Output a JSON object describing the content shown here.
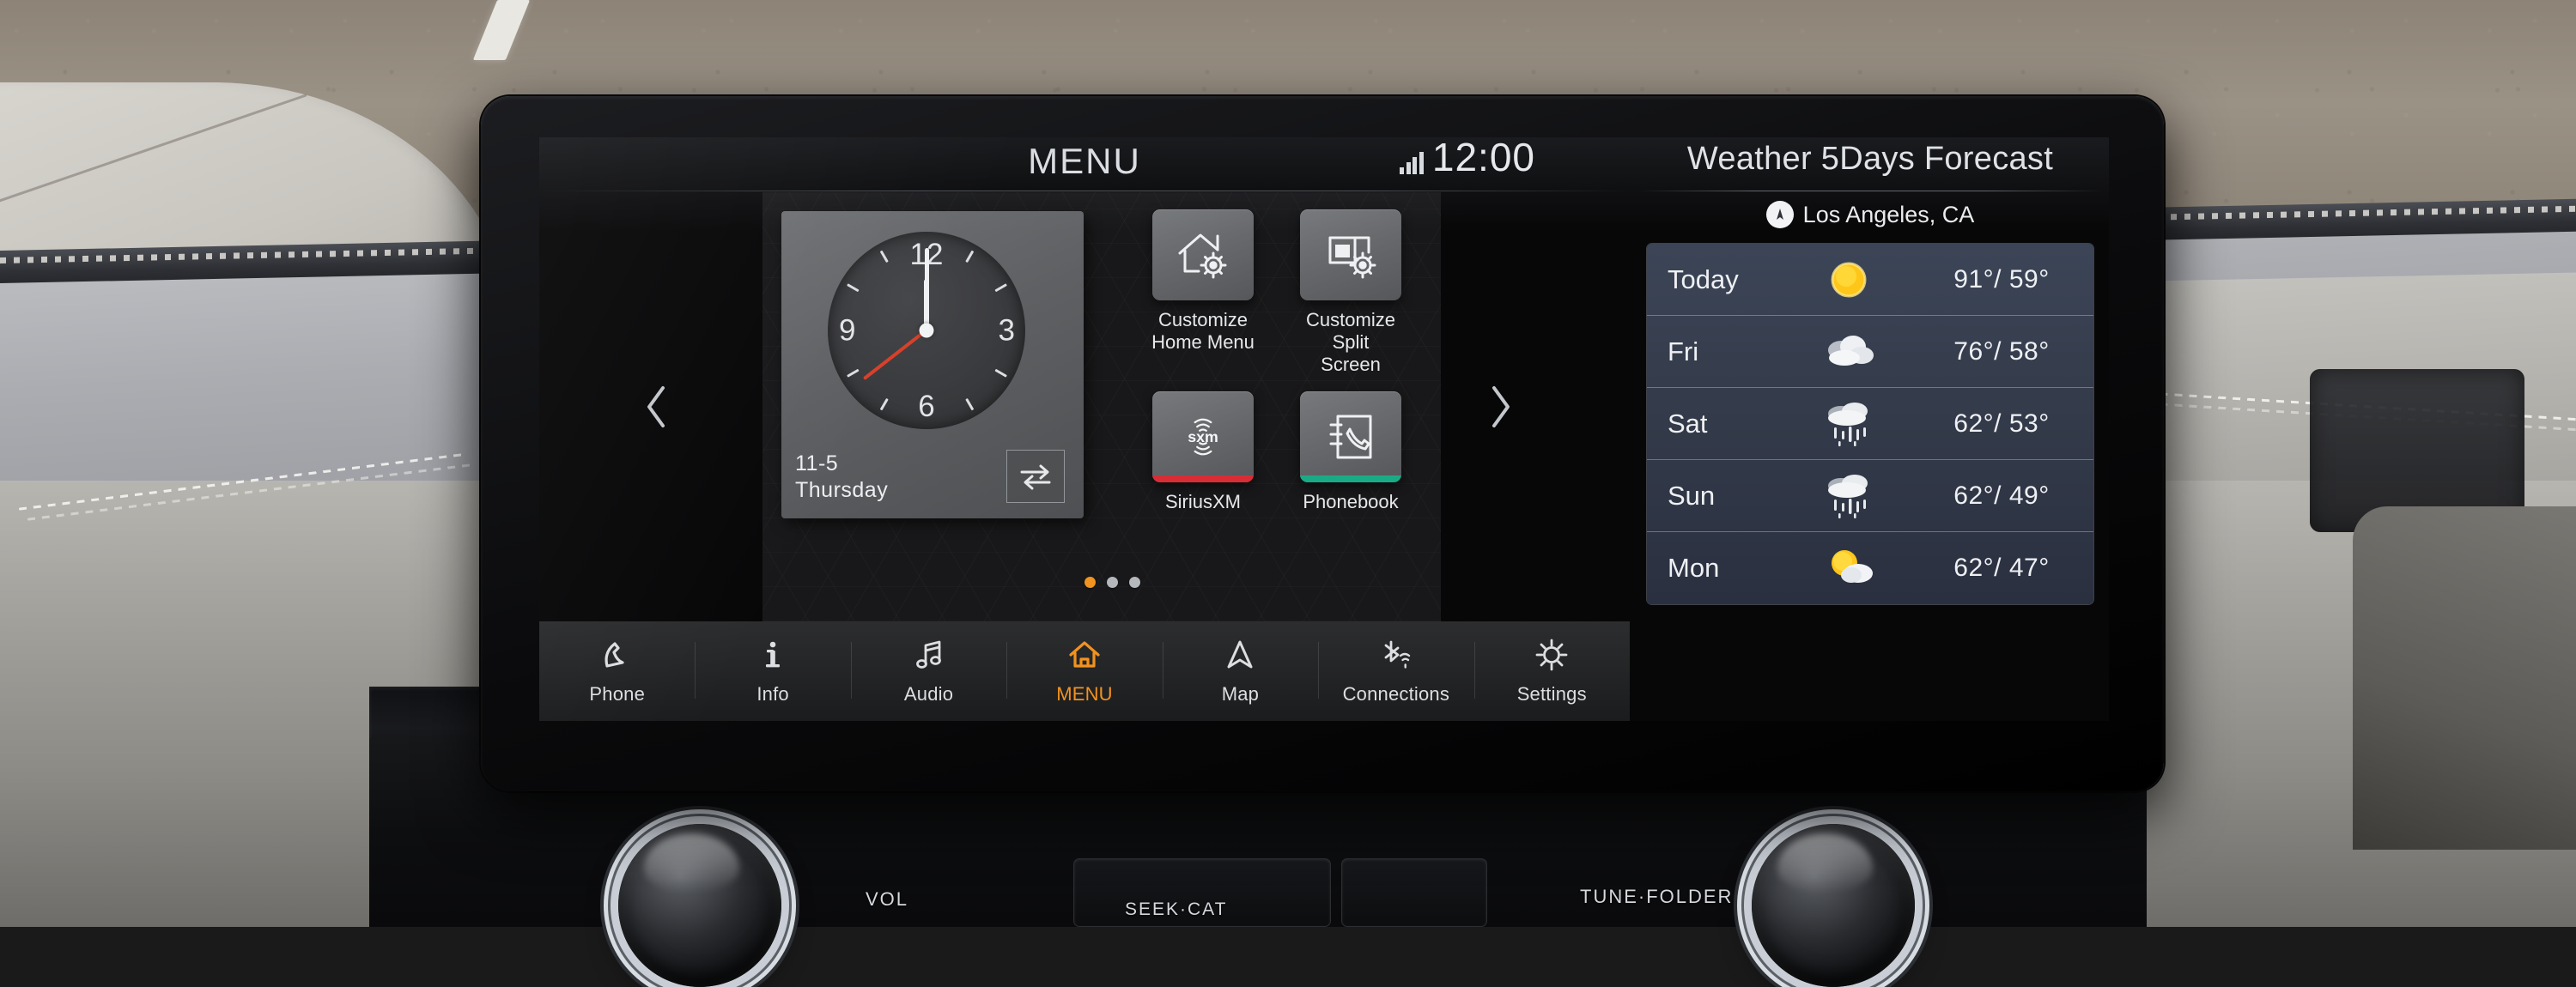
{
  "statusbar": {
    "title": "MENU",
    "time": "12:00",
    "signal_icon": "antenna-signal-bars-icon"
  },
  "home": {
    "prev_icon": "chevron-left-icon",
    "next_icon": "chevron-right-icon",
    "clock_widget": {
      "numerals": [
        "12",
        "3",
        "6",
        "9"
      ],
      "hour_angle": 0,
      "minute_angle": 0,
      "second_angle": -128,
      "date": "11-5",
      "weekday": "Thursday",
      "swap_icon": "swap-arrows-icon"
    },
    "tiles": [
      {
        "label": "Customize\nHome Menu",
        "icon": "house-gear-icon",
        "accent": ""
      },
      {
        "label": "Customize Split\nScreen",
        "icon": "split-screen-gear-icon",
        "accent": ""
      },
      {
        "label": "SiriusXM",
        "icon": "sxm-logo-icon",
        "accent": "#d92d35"
      },
      {
        "label": "Phonebook",
        "icon": "phonebook-icon",
        "accent": "#1aab86"
      }
    ],
    "page_dots": {
      "count": 3,
      "active_index": 0,
      "active_color": "#f29220"
    }
  },
  "weather": {
    "title": "Weather 5Days Forecast",
    "location": "Los Angeles, CA",
    "location_icon": "location-pin-icon",
    "rows": [
      {
        "day": "Today",
        "icon": "sunny-icon",
        "high": "91°",
        "low": "59°",
        "temps": "91°/ 59°"
      },
      {
        "day": "Fri",
        "icon": "cloudy-icon",
        "high": "76°",
        "low": "58°",
        "temps": "76°/ 58°"
      },
      {
        "day": "Sat",
        "icon": "rain-icon",
        "high": "62°",
        "low": "53°",
        "temps": "62°/ 53°"
      },
      {
        "day": "Sun",
        "icon": "rain-icon",
        "high": "62°",
        "low": "49°",
        "temps": "62°/ 49°"
      },
      {
        "day": "Mon",
        "icon": "partly-cloudy-icon",
        "high": "62°",
        "low": "47°",
        "temps": "62°/ 47°"
      }
    ]
  },
  "nav": {
    "active": "MENU",
    "items": [
      {
        "label": "Phone",
        "icon": "phone-handset-icon"
      },
      {
        "label": "Info",
        "icon": "info-icon"
      },
      {
        "label": "Audio",
        "icon": "music-note-icon"
      },
      {
        "label": "MENU",
        "icon": "home-icon"
      },
      {
        "label": "Map",
        "icon": "navigation-arrow-icon"
      },
      {
        "label": "Connections",
        "icon": "bluetooth-wifi-icon"
      },
      {
        "label": "Settings",
        "icon": "gear-icon"
      }
    ]
  },
  "hardware": {
    "vol_label": "VOL",
    "seek_label": "SEEK·CAT",
    "tune_label": "TUNE·FOLDER"
  },
  "colors": {
    "accent_orange": "#f29220",
    "sirius_red": "#d92d35",
    "phonebook_green": "#1aab86",
    "second_hand_red": "#d8402a",
    "weather_panel": "#3c4557"
  }
}
